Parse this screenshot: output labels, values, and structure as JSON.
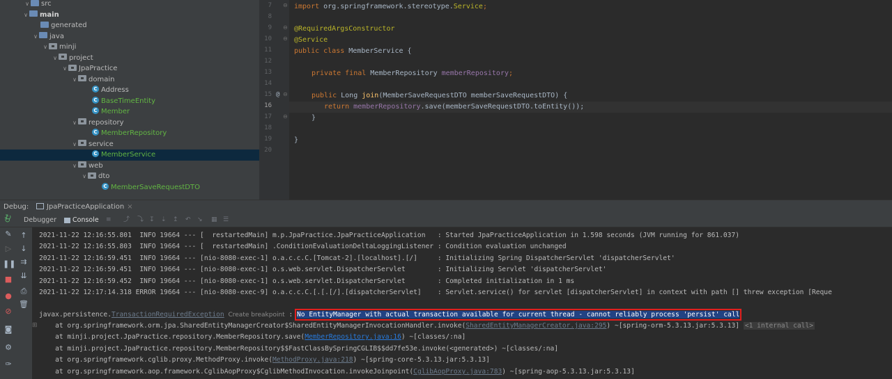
{
  "tree": {
    "items": [
      {
        "label": "src",
        "icon": "folder-icon"
      },
      {
        "label": "main",
        "icon": "folder-icon"
      },
      {
        "label": "generated",
        "icon": "folder-icon"
      },
      {
        "label": "java",
        "icon": "folder-icon"
      },
      {
        "label": "minji",
        "icon": "package-icon"
      },
      {
        "label": "project",
        "icon": "package-icon"
      },
      {
        "label": "JpaPractice",
        "icon": "package-icon"
      },
      {
        "label": "domain",
        "icon": "package-icon"
      },
      {
        "label": "Address",
        "icon": "class-icon"
      },
      {
        "label": "BaseTimeEntity",
        "icon": "class-icon"
      },
      {
        "label": "Member",
        "icon": "class-icon"
      },
      {
        "label": "repository",
        "icon": "package-icon"
      },
      {
        "label": "MemberRepository",
        "icon": "class-icon"
      },
      {
        "label": "service",
        "icon": "package-icon"
      },
      {
        "label": "MemberService",
        "icon": "class-icon"
      },
      {
        "label": "web",
        "icon": "package-icon"
      },
      {
        "label": "dto",
        "icon": "package-icon"
      },
      {
        "label": "MemberSaveRequestDTO",
        "icon": "class-icon"
      }
    ]
  },
  "editor": {
    "line_numbers": [
      "7",
      "8",
      "9",
      "10",
      "11",
      "12",
      "13",
      "14",
      "15",
      "16",
      "17",
      "18",
      "19",
      "20"
    ],
    "gutter_marker": "@",
    "lines": {
      "l7_kw": "import",
      "l7_rest": " org.springframework.stereotype.",
      "l7_svc": "Service",
      "l7_end": ";",
      "l9": "@RequiredArgsConstructor",
      "l10": "@Service",
      "l11_kw": "public class",
      "l11_rest": " MemberService {",
      "l13_kw": "private final",
      "l13_type": " MemberRepository ",
      "l13_field": "memberRepository",
      "l13_end": ";",
      "l15_kw": "public",
      "l15_type": " Long ",
      "l15_fn": "join",
      "l15_rest": "(MemberSaveRequestDTO memberSaveRequestDTO) {",
      "l16_kw": "return",
      "l16_field": " memberRepository",
      "l16_rest": ".save(memberSaveRequestDTO.toEntity());",
      "l17": "}",
      "l19": "}"
    }
  },
  "debug": {
    "label": "Debug:",
    "tab": "JpaPracticeApplication",
    "tab_close": "×",
    "subtabs": {
      "debugger": "Debugger",
      "console": "Console"
    }
  },
  "console": {
    "lines": [
      "2021-11-22 12:16:55.801  INFO 19664 --- [  restartedMain] m.p.JpaPractice.JpaPracticeApplication   : Started JpaPracticeApplication in 1.598 seconds (JVM running for 861.037)",
      "2021-11-22 12:16:55.803  INFO 19664 --- [  restartedMain] .ConditionEvaluationDeltaLoggingListener : Condition evaluation unchanged",
      "2021-11-22 12:16:59.451  INFO 19664 --- [nio-8080-exec-1] o.a.c.c.C.[Tomcat-2].[localhost].[/]     : Initializing Spring DispatcherServlet 'dispatcherServlet'",
      "2021-11-22 12:16:59.451  INFO 19664 --- [nio-8080-exec-1] o.s.web.servlet.DispatcherServlet        : Initializing Servlet 'dispatcherServlet'",
      "2021-11-22 12:16:59.452  INFO 19664 --- [nio-8080-exec-1] o.s.web.servlet.DispatcherServlet        : Completed initialization in 1 ms",
      "2021-11-22 12:17:14.318 ERROR 19664 --- [nio-8080-exec-9] o.a.c.c.C.[.[.[/].[dispatcherServlet]    : Servlet.service() for servlet [dispatcherServlet] in context with path [] threw exception [Reque"
    ],
    "exception": {
      "prefix": "javax.persistence.",
      "name": "TransactionRequiredException",
      "breakpoint": "Create breakpoint",
      "sep": " : ",
      "message": "No EntityManager with actual transaction available for current thread - cannot reliably process 'persist' call"
    },
    "stack": [
      {
        "pre": "    at org.springframework.orm.jpa.SharedEntityManagerCreator$SharedEntityManagerInvocationHandler.invoke(",
        "link": "SharedEntityManagerCreator.java:295",
        "post": ") ~[spring-orm-5.3.13.jar:5.3.13] ",
        "extra": "<1 internal call>",
        "gray": true
      },
      {
        "pre": "    at minji.project.JpaPractice.repository.MemberRepository.save(",
        "link": "MemberRepository.java:16",
        "post": ") ~[classes/:na]",
        "extra": "",
        "gray": false
      },
      {
        "pre": "    at minji.project.JpaPractice.repository.MemberRepository$$FastClassBySpringCGLIB$$dd7fe53e.invoke(<generated>) ~[classes/:na]",
        "link": "",
        "post": "",
        "extra": "",
        "gray": false
      },
      {
        "pre": "    at org.springframework.cglib.proxy.MethodProxy.invoke(",
        "link": "MethodProxy.java:218",
        "post": ") ~[spring-core-5.3.13.jar:5.3.13]",
        "extra": "",
        "gray": true
      },
      {
        "pre": "    at org.springframework.aop.framework.CglibAopProxy$CglibMethodInvocation.invokeJoinpoint(",
        "link": "CglibAopProxy.java:783",
        "post": ") ~[spring-aop-5.3.13.jar:5.3.13]",
        "extra": "",
        "gray": true
      }
    ]
  },
  "colors": {
    "highlight_border": "#e02020",
    "highlight_bg": "#214283",
    "link": "#287bde",
    "class_icon": "#3592c4"
  }
}
